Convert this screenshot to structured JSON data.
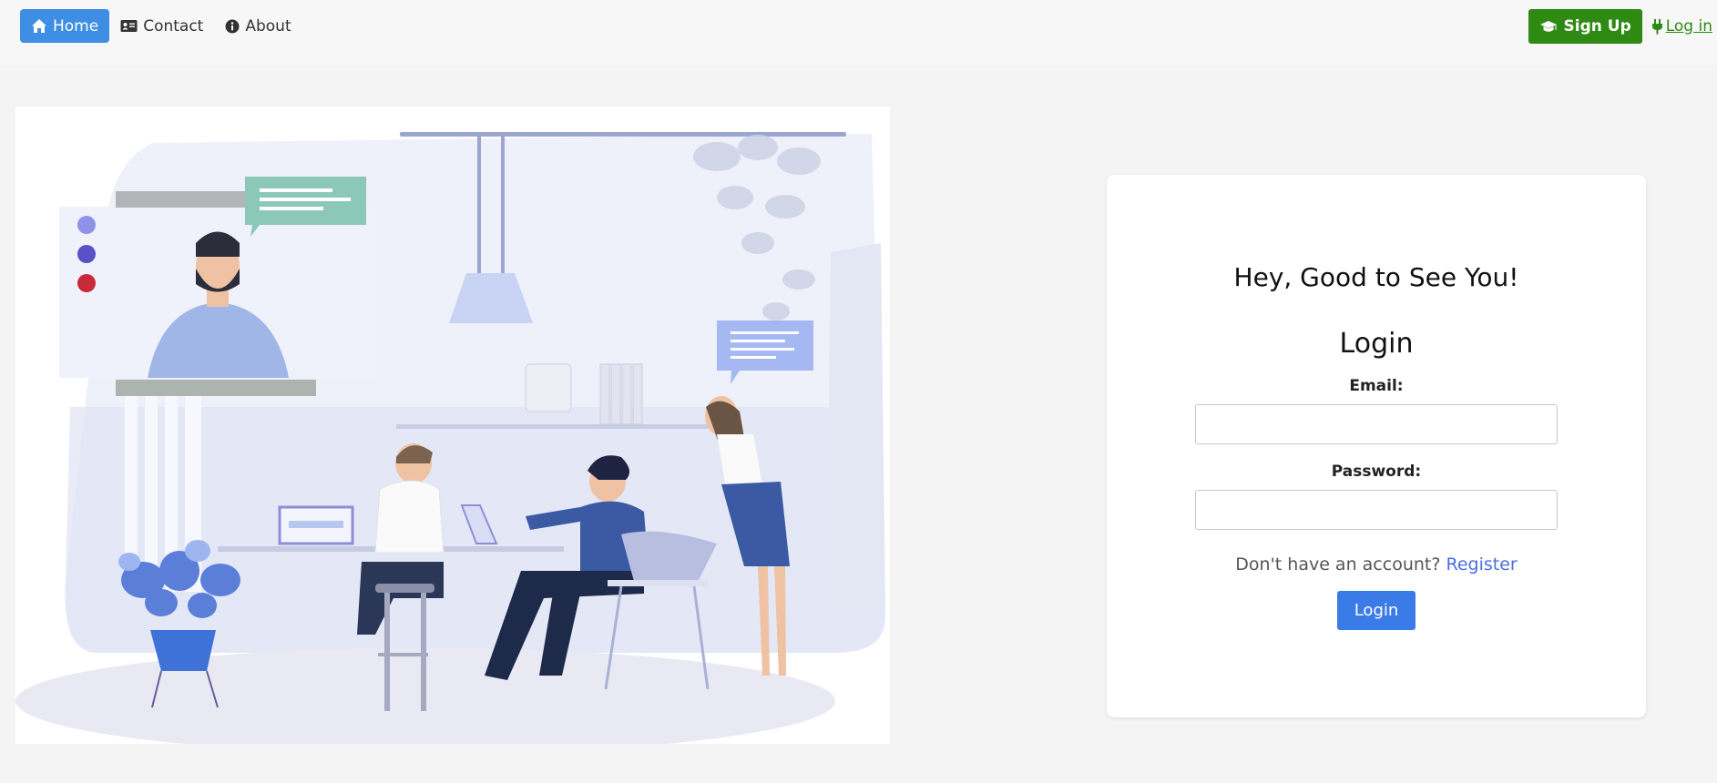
{
  "nav": {
    "home_label": "Home",
    "contact_label": "Contact",
    "about_label": "About",
    "signup_label": "Sign Up",
    "login_label": "Log in"
  },
  "login_card": {
    "greeting": "Hey, Good to See You!",
    "title": "Login",
    "email_label": "Email:",
    "email_value": "",
    "password_label": "Password:",
    "password_value": "",
    "register_prompt": "Don't have an account?",
    "register_link": "Register",
    "submit_label": "Login"
  },
  "colors": {
    "home_active": "#3e8ee6",
    "signup": "#2f8a14",
    "login_button": "#3b7be8",
    "register_link": "#4a6ee0"
  },
  "icons": {
    "home": "home-icon",
    "contact": "id-card-icon",
    "about": "info-icon",
    "signup": "graduation-cap-icon",
    "login": "plug-icon"
  }
}
